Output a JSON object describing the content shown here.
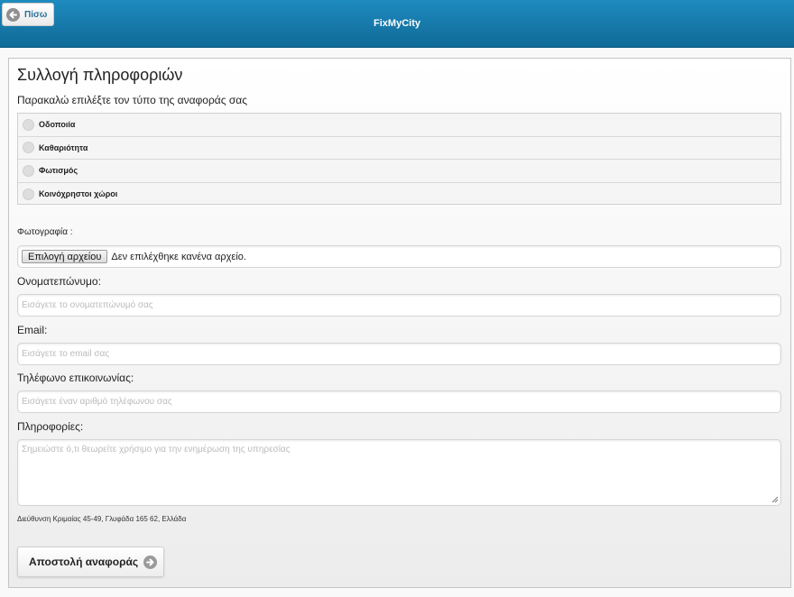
{
  "header": {
    "back_label": "Πίσω",
    "title": "FixMyCity"
  },
  "form": {
    "title": "Συλλογή πληροφοριών",
    "instruction": "Παρακαλώ επιλέξτε τον τύπο της αναφοράς σας",
    "report_types": [
      {
        "label": "Οδοποιία",
        "selected": false
      },
      {
        "label": "Καθαριότητα",
        "selected": false
      },
      {
        "label": "Φωτισμός",
        "selected": false
      },
      {
        "label": "Κοινόχρηστοι χώροι",
        "selected": false
      }
    ],
    "photo": {
      "label": "Φωτογραφία :",
      "button_label": "Επιλογή αρχείου",
      "status": "Δεν επιλέχθηκε κανένα αρχείο."
    },
    "fullname": {
      "label": "Ονοματεπώνυμο:",
      "placeholder": "Εισάγετε το ονοματεπώνυμό σας",
      "value": ""
    },
    "email": {
      "label": "Email:",
      "placeholder": "Εισάγετε το email σας",
      "value": ""
    },
    "phone": {
      "label": "Τηλέφωνο επικοινωνίας:",
      "placeholder": "Εισάγετε έναν αριθμό τηλέφωνου σας",
      "value": ""
    },
    "info": {
      "label": "Πληροφορίες:",
      "placeholder": "Σημειώστε ό,τι θεωρείτε χρήσιμο για την ενημέρωση της υπηρεσίας",
      "value": ""
    },
    "address": "Διεύθυνση Κριμαίας 45-49, Γλυφάδα 165 62, Ελλάδα",
    "submit_label": "Αποστολή αναφοράς"
  },
  "icons": {
    "back": "arrow-left-circle-icon",
    "submit": "arrow-right-circle-icon"
  },
  "colors": {
    "header_top": "#1e8bbf",
    "header_bottom": "#106a97",
    "back_text": "#2a6f9a",
    "placeholder": "#bbbbbb"
  }
}
